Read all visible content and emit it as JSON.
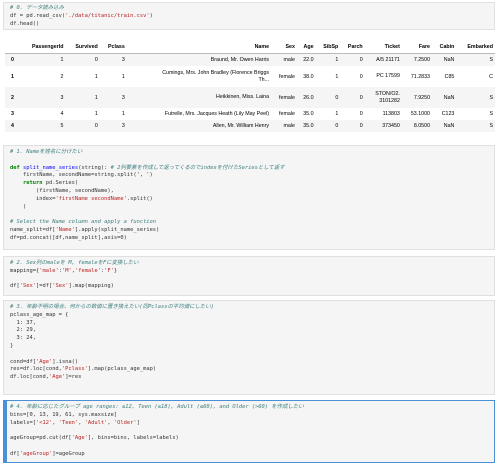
{
  "cells": {
    "c0": {
      "comment": "# 0. データ読み込み",
      "line1_pre": "df = pd.read_csv(",
      "line1_str": "'./data/titanic/train.csv'",
      "line1_post": ")",
      "line2": "df.head()"
    },
    "table": {
      "columns": [
        "",
        "PassengerId",
        "Survived",
        "Pclass",
        "Name",
        "Sex",
        "Age",
        "SibSp",
        "Parch",
        "Ticket",
        "Fare",
        "Cabin",
        "Embarked"
      ],
      "rows": [
        {
          "idx": "0",
          "pid": "1",
          "surv": "0",
          "pclass": "3",
          "name1": "Braund, Mr. Owen Harris",
          "name2": "",
          "sex": "male",
          "age": "22.0",
          "sibsp": "1",
          "parch": "0",
          "ticket1": "A/5 21171",
          "ticket2": "",
          "fare": "7.2500",
          "cabin": "NaN",
          "emb": "S"
        },
        {
          "idx": "1",
          "pid": "2",
          "surv": "1",
          "pclass": "1",
          "name1": "Cumings, Mrs. John Bradley (Florence Briggs",
          "name2": "Th...",
          "sex": "female",
          "age": "38.0",
          "sibsp": "1",
          "parch": "0",
          "ticket1": "PC 17599",
          "ticket2": "",
          "fare": "71.2833",
          "cabin": "C85",
          "emb": "C"
        },
        {
          "idx": "2",
          "pid": "3",
          "surv": "1",
          "pclass": "3",
          "name1": "Heikkinen, Miss. Laina",
          "name2": "",
          "sex": "female",
          "age": "26.0",
          "sibsp": "0",
          "parch": "0",
          "ticket1": "STON/O2.",
          "ticket2": "3101282",
          "fare": "7.9250",
          "cabin": "NaN",
          "emb": "S"
        },
        {
          "idx": "3",
          "pid": "4",
          "surv": "1",
          "pclass": "1",
          "name1": "Futrelle, Mrs. Jacques Heath (Lily May Peel)",
          "name2": "",
          "sex": "female",
          "age": "35.0",
          "sibsp": "1",
          "parch": "0",
          "ticket1": "113803",
          "ticket2": "",
          "fare": "53.1000",
          "cabin": "C123",
          "emb": "S"
        },
        {
          "idx": "4",
          "pid": "5",
          "surv": "0",
          "pclass": "3",
          "name1": "Allen, Mr. William Henry",
          "name2": "",
          "sex": "male",
          "age": "35.0",
          "sibsp": "0",
          "parch": "0",
          "ticket1": "373450",
          "ticket2": "",
          "fare": "8.0500",
          "cabin": "NaN",
          "emb": "S"
        }
      ]
    },
    "c1": {
      "comment1": "# 1. Nameを姓名に分けたい",
      "def_kw": "def",
      "def_name": "split_name_series",
      "def_sig": "(string):",
      "def_comment": "# 2列要素を作成して返ってくるのでindexを付けたSeriesとして返す",
      "l2": "    firstName, secondName=string.split(', ')",
      "l3_kw": "return",
      "l3_rest": " pd.Series(",
      "l4": "        (firstName, secondName),",
      "l5_pre": "        index=",
      "l5_str": "'firstName secondName'",
      "l5_post": ".split()",
      "l6": "    )",
      "comment2": "# Select the Name column and apply a function",
      "l8_pre": "name_split=df[",
      "l8_str": "'Name'",
      "l8_post": "].apply(split_name_series)",
      "l9": "df=pd.concat([df,name_split],axis=0)"
    },
    "c2": {
      "comment": "# 2. Sex列のmaleを M, femaleをFに変換したい",
      "l1_pre": "mapping={",
      "l1_s1": "'male'",
      "l1_m": ":",
      "l1_s2": "'M'",
      "l1_c": ",",
      "l1_s3": "'female'",
      "l1_m2": ":",
      "l1_s4": "'F'",
      "l1_post": "}",
      "l3_pre": "df[",
      "l3_s1": "'Sex'",
      "l3_mid": "]=df[",
      "l3_s2": "'Sex'",
      "l3_post": "].map(mapping)"
    },
    "c3": {
      "comment": "# 3. 年齢不明の場合、何からの数値に置き換えたい(同Pclassの平均値にしたい)",
      "l1": "pclass_age_map = {",
      "l2": "  1: 37,",
      "l3": "  2: 29,",
      "l4": "  3: 24,",
      "l5": "}",
      "l7_pre": "cond=df[",
      "l7_str": "'Age'",
      "l7_post": "].isna()",
      "l8_pre": "res=df.loc[cond,",
      "l8_str": "'Pclass'",
      "l8_post": "].map(pclass_age_map)",
      "l9_pre": "df.loc[cond,",
      "l9_str": "'Age'",
      "l9_post": "]=res"
    },
    "c4": {
      "comment": "# 4. 年齢に応じたグループ age ranges: ≤12, Teen (≤18), Adult (≤60), and Older (>60) を作成したい",
      "l1": "bins=[0, 13, 19, 61, sys.maxsize]",
      "l2_pre": "labels=[",
      "l2_s1": "'<12'",
      "l2_c1": ", ",
      "l2_s2": "'Teen'",
      "l2_c2": ", ",
      "l2_s3": "'Adult'",
      "l2_c3": ", ",
      "l2_s4": "'Older'",
      "l2_post": "]",
      "l4_pre": "ageGroup=pd.cut(df[",
      "l4_str": "'Age'",
      "l4_post": "], bins=bins, labels=labels)",
      "l6_pre": "df[",
      "l6_str": "'ageGroup'",
      "l6_post": "]=ageGroup"
    }
  }
}
